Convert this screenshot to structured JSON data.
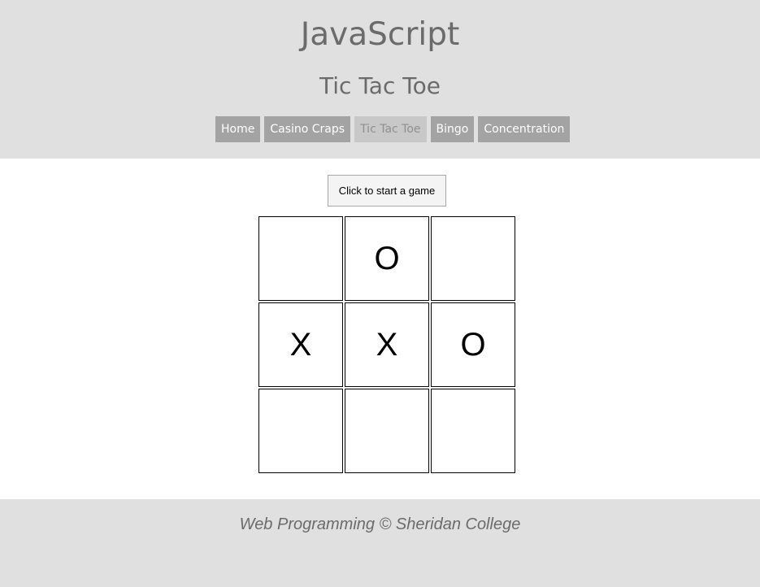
{
  "header": {
    "site_title": "JavaScript",
    "page_title": "Tic Tac Toe"
  },
  "nav": {
    "items": [
      {
        "label": "Home",
        "active": false
      },
      {
        "label": "Casino Craps",
        "active": false
      },
      {
        "label": "Tic Tac Toe",
        "active": true
      },
      {
        "label": "Bingo",
        "active": false
      },
      {
        "label": "Concentration",
        "active": false
      }
    ]
  },
  "game": {
    "start_button_label": "Click to start a game",
    "board": [
      [
        "",
        "O",
        ""
      ],
      [
        "X",
        "X",
        "O"
      ],
      [
        "",
        "",
        ""
      ]
    ]
  },
  "footer": {
    "text": "Web Programming © Sheridan College"
  },
  "colors": {
    "header_bg": "#e0e0e0",
    "nav_bg": "#a3a3a3",
    "nav_active_bg": "#c8c8c8",
    "title_text": "#6b6b6b"
  }
}
